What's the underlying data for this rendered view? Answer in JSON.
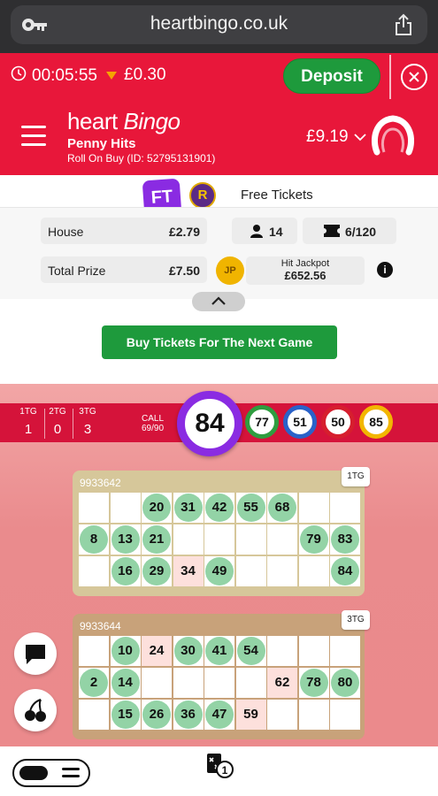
{
  "browser": {
    "url": "heartbingo.co.uk"
  },
  "topbar": {
    "timer": "00:05:55",
    "price": "£0.30",
    "deposit_label": "Deposit"
  },
  "header": {
    "logo_heart": "heart",
    "logo_bingo": "Bingo",
    "game_name": "Penny Hits",
    "game_sub": "Roll On Buy (ID: 52795131901)",
    "balance": "£9.19"
  },
  "info": {
    "badge_ft": "FT",
    "badge_r": "R",
    "free_tickets": "Free Tickets",
    "house_label": "House",
    "house_value": "£2.79",
    "players": "14",
    "tickets": "6/120",
    "total_prize_label": "Total Prize",
    "total_prize_value": "£7.50",
    "jp_badge": "JP",
    "hit_jackpot_label": "Hit Jackpot",
    "hit_jackpot_value": "£652.56",
    "info_glyph": "i",
    "buy_label": "Buy Tickets For The Next Game"
  },
  "call_bar": {
    "tg": [
      {
        "label": "1TG",
        "value": "1"
      },
      {
        "label": "2TG",
        "value": "0"
      },
      {
        "label": "3TG",
        "value": "3"
      }
    ],
    "call_label": "CALL",
    "call_count": "69/90",
    "current_ball": "84",
    "previous_balls": [
      {
        "number": "77",
        "color": "#2e9d3f"
      },
      {
        "number": "51",
        "color": "#2a62c9"
      },
      {
        "number": "50",
        "color": "#d61e2e"
      },
      {
        "number": "85",
        "color": "#f2b600"
      }
    ]
  },
  "tickets": [
    {
      "id": "9933642",
      "tag": "1TG",
      "color": "#d6c79a",
      "rows": [
        [
          {
            "n": ""
          },
          {
            "n": ""
          },
          {
            "n": "20",
            "m": true
          },
          {
            "n": "31",
            "m": true
          },
          {
            "n": "42",
            "m": true
          },
          {
            "n": "55",
            "m": true
          },
          {
            "n": "68",
            "m": true
          },
          {
            "n": ""
          },
          {
            "n": ""
          }
        ],
        [
          {
            "n": "8",
            "m": true
          },
          {
            "n": "13",
            "m": true
          },
          {
            "n": "21",
            "m": true
          },
          {
            "n": ""
          },
          {
            "n": ""
          },
          {
            "n": ""
          },
          {
            "n": ""
          },
          {
            "n": "79",
            "m": true
          },
          {
            "n": "83",
            "m": true
          }
        ],
        [
          {
            "n": ""
          },
          {
            "n": "16",
            "m": true
          },
          {
            "n": "29",
            "m": true
          },
          {
            "n": "34",
            "p": true
          },
          {
            "n": "49",
            "m": true
          },
          {
            "n": ""
          },
          {
            "n": ""
          },
          {
            "n": ""
          },
          {
            "n": "84",
            "m": true
          }
        ]
      ]
    },
    {
      "id": "9933644",
      "tag": "3TG",
      "color": "#c8a27a",
      "rows": [
        [
          {
            "n": ""
          },
          {
            "n": "10",
            "m": true
          },
          {
            "n": "24",
            "p": true
          },
          {
            "n": "30",
            "m": true
          },
          {
            "n": "41",
            "m": true
          },
          {
            "n": "54",
            "m": true
          },
          {
            "n": ""
          },
          {
            "n": ""
          },
          {
            "n": ""
          }
        ],
        [
          {
            "n": "2",
            "m": true
          },
          {
            "n": "14",
            "m": true
          },
          {
            "n": ""
          },
          {
            "n": ""
          },
          {
            "n": ""
          },
          {
            "n": ""
          },
          {
            "n": "62",
            "p": true
          },
          {
            "n": "78",
            "m": true
          },
          {
            "n": "80",
            "m": true
          }
        ],
        [
          {
            "n": ""
          },
          {
            "n": "15",
            "m": true
          },
          {
            "n": "26",
            "m": true
          },
          {
            "n": "36",
            "m": true
          },
          {
            "n": "47",
            "m": true
          },
          {
            "n": "59",
            "p": true
          },
          {
            "n": ""
          },
          {
            "n": ""
          },
          {
            "n": ""
          }
        ]
      ]
    }
  ],
  "icons": {
    "key": "key-icon",
    "share": "share-icon",
    "clock": "clock-icon",
    "close": "close-icon",
    "menu": "hamburger-menu-icon",
    "avatar": "avatar-icon",
    "chat": "chat-icon",
    "cherries": "cherries-icon",
    "toggle": "view-toggle-icon",
    "auto_daub": "auto-daub-icon"
  }
}
